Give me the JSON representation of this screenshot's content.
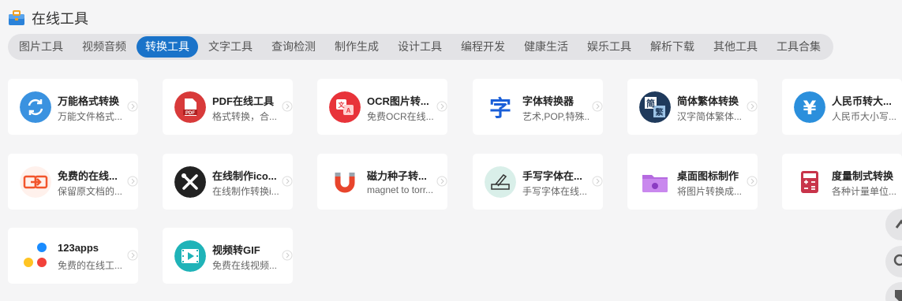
{
  "header": {
    "title": "在线工具"
  },
  "tabs": [
    "图片工具",
    "视频音频",
    "转换工具",
    "文字工具",
    "查询检测",
    "制作生成",
    "设计工具",
    "编程开发",
    "健康生活",
    "娱乐工具",
    "解析下载",
    "其他工具",
    "工具合集"
  ],
  "active_tab": "转换工具",
  "tools": [
    {
      "name": "万能格式转换",
      "desc": "万能文件格式...",
      "icon": "sync-icon"
    },
    {
      "name": "PDF在线工具",
      "desc": "格式转换，合...",
      "icon": "pdf-icon"
    },
    {
      "name": "OCR图片转...",
      "desc": "免费OCR在线...",
      "icon": "ocr-translate-icon"
    },
    {
      "name": "字体转换器",
      "desc": "艺术,POP,特殊...",
      "icon": "font-char-icon"
    },
    {
      "name": "简体繁体转换",
      "desc": "汉字简体繁体...",
      "icon": "simplified-traditional-icon"
    },
    {
      "name": "人民币转大...",
      "desc": "人民币大小写...",
      "icon": "yuan-icon"
    },
    {
      "name": "免费的在线...",
      "desc": "保留原文档的...",
      "icon": "convert-arrows-icon"
    },
    {
      "name": "在线制作ico...",
      "desc": "在线制作转换i...",
      "icon": "tools-icon"
    },
    {
      "name": "磁力种子转...",
      "desc": "magnet to torr...",
      "icon": "magnet-icon"
    },
    {
      "name": "手写字体在...",
      "desc": "手写字体在线...",
      "icon": "handwriting-icon"
    },
    {
      "name": "桌面图标制作",
      "desc": "将图片转换成...",
      "icon": "folder-icon"
    },
    {
      "name": "度量制式转换",
      "desc": "各种计量单位...",
      "icon": "calculator-icon"
    },
    {
      "name": "123apps",
      "desc": "免费的在线工...",
      "icon": "dots-icon"
    },
    {
      "name": "视频转GIF",
      "desc": "免费在线视频...",
      "icon": "film-icon"
    }
  ],
  "colors": {
    "accent": "#1a73c9",
    "background": "#f5f5f6",
    "tab_bar": "#e3e3e6"
  }
}
